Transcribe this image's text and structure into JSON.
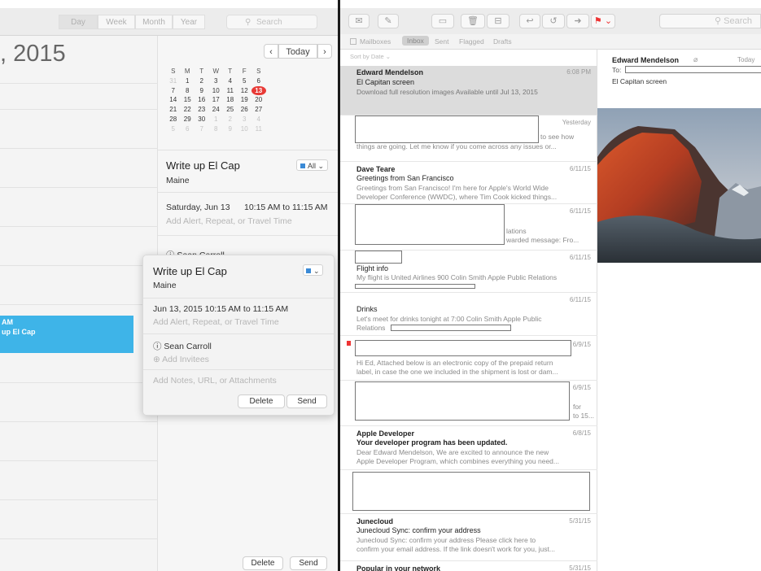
{
  "calendar": {
    "view_tabs": [
      "Day",
      "Week",
      "Month",
      "Year"
    ],
    "search_placeholder": "Search",
    "search_icon": "magnifier-icon",
    "date_heading": ", 2015",
    "event_block": {
      "time": "AM",
      "title": "up El Cap"
    },
    "nav": {
      "prev": "‹",
      "today": "Today",
      "next": "›"
    },
    "mini_calendar": {
      "weekday_headers": [
        "S",
        "M",
        "T",
        "W",
        "T",
        "F",
        "S"
      ],
      "weeks": [
        [
          "31",
          "1",
          "2",
          "3",
          "4",
          "5",
          "6"
        ],
        [
          "7",
          "8",
          "9",
          "10",
          "11",
          "12",
          "13"
        ],
        [
          "14",
          "15",
          "16",
          "17",
          "18",
          "19",
          "20"
        ],
        [
          "21",
          "22",
          "23",
          "24",
          "25",
          "26",
          "27"
        ],
        [
          "28",
          "29",
          "30",
          "1",
          "2",
          "3",
          "4"
        ],
        [
          "5",
          "6",
          "7",
          "8",
          "9",
          "10",
          "11"
        ]
      ],
      "today": "13"
    },
    "event_panel": {
      "title": "Write up El Cap",
      "calendar_select": "All",
      "location": "Maine",
      "date": "Saturday, Jun 13",
      "time": "10:15 AM to 11:15 AM",
      "alert_placeholder": "Add Alert, Repeat, or Travel Time",
      "invitee": "Sean Carroll",
      "delete_label": "Delete",
      "send_label": "Send"
    },
    "popover": {
      "title": "Write up El Cap",
      "location": "Maine",
      "date_time": "Jun 13, 2015  10:15 AM to 11:15 AM",
      "alert_placeholder": "Add Alert, Repeat, or Travel Time",
      "invitee": "Sean Carroll",
      "add_invitees": "Add Invitees",
      "notes_placeholder": "Add Notes, URL, or Attachments",
      "delete_label": "Delete",
      "send_label": "Send"
    }
  },
  "mail": {
    "search_placeholder": "Search",
    "favorites": [
      "Mailboxes",
      "Inbox",
      "Sent",
      "Flagged",
      "Drafts"
    ],
    "sort_label": "Sort by Date",
    "messages": [
      {
        "from": "Edward Mendelson",
        "date": "6:08 PM",
        "subject": "El Capitan screen",
        "preview": "Download full resolution images Available until Jul 13, 2015"
      },
      {
        "from": "",
        "date": "Yesterday",
        "subject": "",
        "preview": "to see how",
        "preview2": "things are going. Let me know if you come across any issues or..."
      },
      {
        "from": "Dave Teare",
        "date": "6/11/15",
        "subject": "Greetings from San Francisco",
        "preview": "Greetings from San Francisco! I'm here for Apple's World Wide",
        "preview2": "Developer Conference (WWDC), where Tim Cook kicked things..."
      },
      {
        "from": "",
        "date": "6/11/15",
        "subject": "",
        "preview": "lations",
        "preview2": "warded message: Fro..."
      },
      {
        "from": "",
        "date": "6/11/15",
        "subject": "Flight info",
        "preview": "My flight is United Airlines 900 Colin Smith Apple Public Relations"
      },
      {
        "from": "",
        "date": "6/11/15",
        "subject": "Drinks",
        "preview": "Let's meet for drinks tonight at 7:00 Colin Smith Apple Public",
        "preview2": "Relations"
      },
      {
        "from": "",
        "date": "6/9/15",
        "subject": "",
        "preview": "Hi Ed, Attached below is an electronic copy of the prepaid return",
        "preview2": "label, in case the one we included in the shipment is lost or dam..."
      },
      {
        "from": "",
        "date": "6/9/15",
        "subject": "",
        "preview": "for",
        "preview2": "to 15..."
      },
      {
        "from": "Apple Developer",
        "date": "6/8/15",
        "subject": "Your developer program has been updated.",
        "preview": "Dear Edward Mendelson, We are excited to announce the new",
        "preview2": "Apple Developer Program, which combines everything you need..."
      },
      {
        "from": "Junecloud",
        "date": "5/31/15",
        "subject": "Junecloud Sync: confirm your address",
        "preview": "Junecloud Sync: confirm your address Please click here to",
        "preview2": "confirm your email address. If the link doesn't work for you, just..."
      },
      {
        "from": "Popular in your network",
        "date": "5/31/15",
        "subject": "",
        "preview": ""
      }
    ],
    "reading": {
      "from": "Edward Mendelson",
      "date": "Today",
      "to_label": "To:",
      "subject": "El Capitan screen",
      "attachment_icon": "paperclip-icon"
    },
    "colors": {
      "flag": "#e33333",
      "selected": "#dcdcdc",
      "today": "#e83a36",
      "event": "#3eb4e8"
    }
  }
}
